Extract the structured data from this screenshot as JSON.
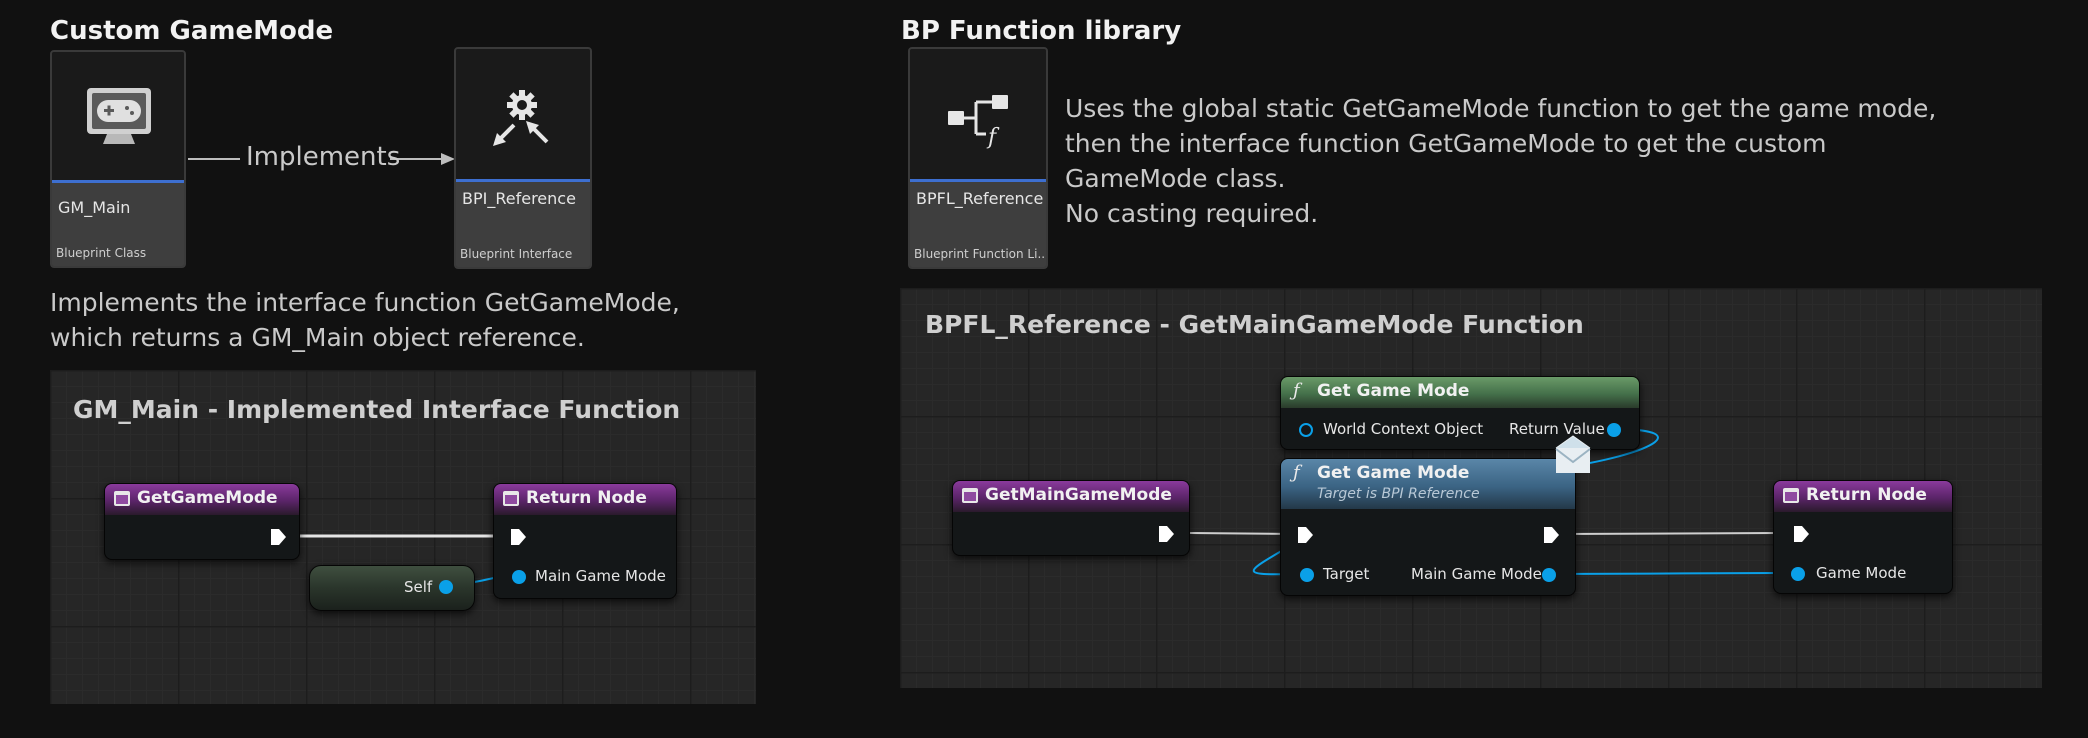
{
  "left": {
    "title": "Custom GameMode",
    "gm_tile": {
      "name": "GM_Main",
      "type": "Blueprint Class",
      "icon": "game-monitor-icon"
    },
    "arrow_label": "Implements",
    "bpi_tile": {
      "name": "BPI_Reference",
      "type": "Blueprint Interface",
      "icon": "interface-gear-icon"
    },
    "desc_line1": "Implements the interface function GetGameMode,",
    "desc_line2": "which returns a GM_Main object reference.",
    "graph": {
      "title": "GM_Main - Implemented Interface Function",
      "entry_node": "GetGameMode",
      "return_node": "Return Node",
      "self_node": "Self",
      "return_pin": "Main Game Mode"
    }
  },
  "right": {
    "title": "BP Function library",
    "bpfl_tile": {
      "name": "BPFL_Reference",
      "type": "Blueprint Function Li...",
      "icon": "function-library-icon"
    },
    "desc_line1": " Uses the global static GetGameMode function to get the game mode,",
    "desc_line2": "then the interface function GetGameMode to get the custom",
    "desc_line3": "GameMode class.",
    "desc_line4": "No casting required.",
    "graph": {
      "title": "BPFL_Reference - GetMainGameMode Function",
      "entry_node": "GetMainGameMode",
      "global_node": {
        "title": "Get Game Mode",
        "in_pin": "World Context Object",
        "out_pin": "Return Value"
      },
      "interface_node": {
        "title": "Get Game Mode",
        "subtitle": "Target is BPI Reference",
        "in_pin": "Target",
        "out_pin": "Main Game Mode"
      },
      "return_node": "Return Node",
      "return_pin": "Game Mode"
    }
  },
  "colors": {
    "exec_wire": "#e6e6e6",
    "object_pin": "#0aa0e8",
    "graph_bg": "#262626",
    "accent_bar": "#3d6fd0"
  }
}
